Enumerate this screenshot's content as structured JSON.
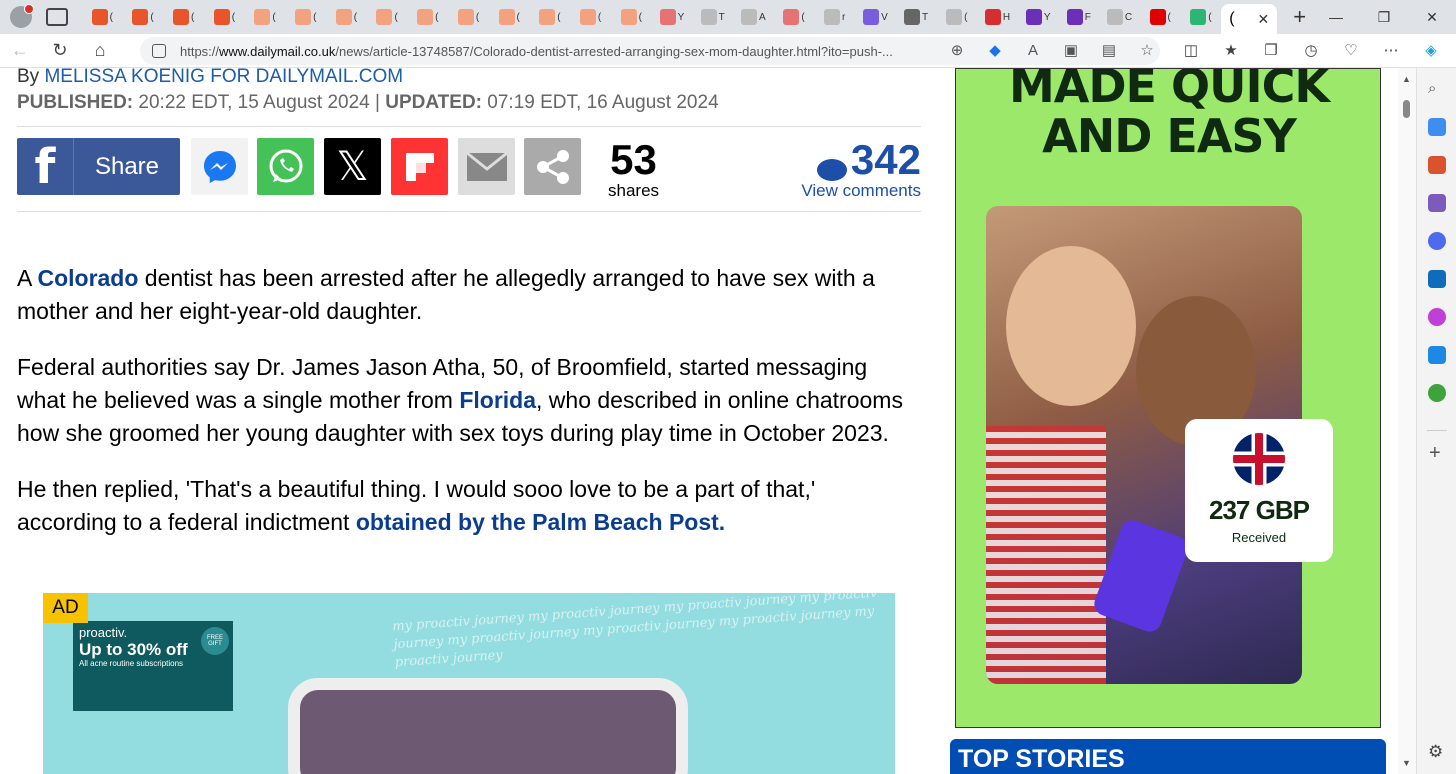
{
  "browser": {
    "url_prefix": "https://",
    "url_domain": "www.dailymail.co.uk",
    "url_path": "/news/article-13748587/Colorado-dentist-arrested-arranging-sex-mom-daughter.html?ito=push-...",
    "tab_favicons": [
      "#e8552a",
      "#e8552a",
      "#e8552a",
      "#e8552a",
      "#f2a27e",
      "#f2a27e",
      "#f2a27e",
      "#f2a27e",
      "#f2a27e",
      "#f2a27e",
      "#f2a27e",
      "#f2a27e",
      "#f2a27e",
      "#f2a27e",
      "#e57373",
      "#bbbbbb",
      "#bbbbbb",
      "#e57373",
      "#bbbbbb",
      "#7a5ce0",
      "#666666",
      "#bbbbbb",
      "#d32f2f",
      "#6b2fb8",
      "#6b2fb8",
      "#bbbbbb",
      "#e00000",
      "#2bb673"
    ],
    "tab_letters": [
      "(",
      "(",
      "(",
      "(",
      "(",
      "(",
      "(",
      "(",
      "(",
      "(",
      "(",
      "(",
      "(",
      "(",
      "Y",
      "T",
      "A",
      "(",
      "r",
      "V",
      "T",
      "(",
      "H",
      "Y",
      "F",
      "C",
      "(",
      "("
    ],
    "active_tab_label": "(",
    "close_glyph": "✕",
    "new_tab_glyph": "+",
    "window_controls": [
      "—",
      "❐",
      "✕"
    ]
  },
  "article": {
    "byline_prefix": "By ",
    "author": "MELISSA KOENIG FOR DAILYMAIL.COM",
    "published_label": "PUBLISHED:",
    "published_value": " 20:22 EDT, 15 August 2024",
    "separator": " | ",
    "updated_label": "UPDATED:",
    "updated_value": " 07:19 EDT, 16 August 2024",
    "share_label": "Share",
    "share_count": "53",
    "share_count_label": "shares",
    "comment_count": "342",
    "view_comments": "View comments",
    "p1_a": "A ",
    "p1_link": "Colorado",
    "p1_b": " dentist has been arrested after he allegedly arranged to have sex with a mother and her eight-year-old daughter.",
    "p2_a": "Federal authorities say Dr. James Jason Atha, 50, of Broomfield, started messaging what he believed was a single mother from ",
    "p2_link": "Florida",
    "p2_b": ", who described in online chatrooms how she groomed her young daughter with sex toys during play time in October 2023.",
    "p3_a": "He then replied, 'That's a beautiful thing. I would sooo love to be a part of that,' according to a federal indictment ",
    "p3_link": "obtained by the Palm Beach Post."
  },
  "inline_ad": {
    "label": "AD",
    "brand": "proactiv.",
    "offer": "Up to 30% off",
    "small": "All acne routine subscriptions",
    "badge": "FREE GIFT",
    "script_text": "my proactiv journey my proactiv journey my proactiv journey my proactiv journey my proactiv journey my proactiv journey my proactiv journey my proactiv journey"
  },
  "side_ad": {
    "headline_line1": "MADE QUICK",
    "headline_line2": "AND EASY",
    "amount": "237 GBP",
    "status": "Received"
  },
  "sidebar": {
    "top_stories": "TOP STORIES"
  },
  "colors": {
    "link_blue": "#0a3d8f",
    "facebook": "#3b5998",
    "whatsapp": "#45c257",
    "flipboard": "#ff3333",
    "ad_green": "#9be86a",
    "top_stories_blue": "#004db3"
  }
}
